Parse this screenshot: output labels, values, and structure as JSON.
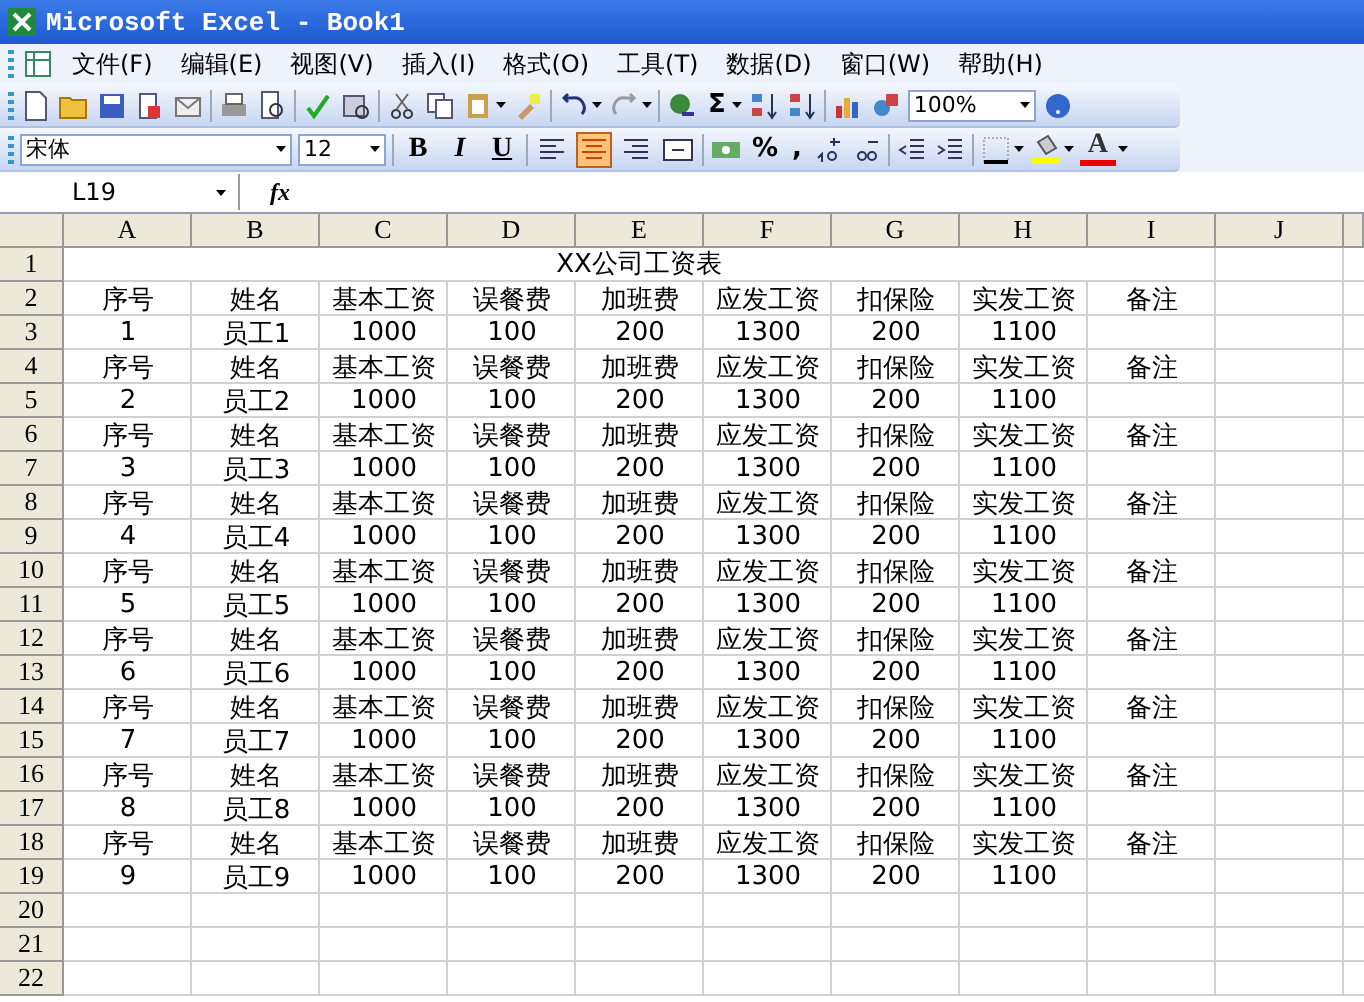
{
  "window": {
    "title": "Microsoft Excel - Book1"
  },
  "menu": [
    {
      "label": "文件(F)"
    },
    {
      "label": "编辑(E)"
    },
    {
      "label": "视图(V)"
    },
    {
      "label": "插入(I)"
    },
    {
      "label": "格式(O)"
    },
    {
      "label": "工具(T)"
    },
    {
      "label": "数据(D)"
    },
    {
      "label": "窗口(W)"
    },
    {
      "label": "帮助(H)"
    }
  ],
  "standard_toolbar": {
    "sum": "Σ",
    "zoom": "100%"
  },
  "formatting_toolbar": {
    "font_name": "宋体",
    "font_size": "12",
    "styles": [
      {
        "label": "B",
        "selected": false
      },
      {
        "label": "I",
        "selected": false
      },
      {
        "label": "U",
        "selected": false
      }
    ],
    "alignment": [
      {
        "kind": "left",
        "selected": false
      },
      {
        "kind": "center",
        "selected": true
      },
      {
        "kind": "right",
        "selected": false
      },
      {
        "kind": "merge",
        "selected": false
      }
    ],
    "percent": "%",
    "comma": ",",
    "font_color": "A"
  },
  "formula_bar": {
    "name_box": "L19",
    "fx": "fx"
  },
  "sheet": {
    "columns": [
      "A",
      "B",
      "C",
      "D",
      "E",
      "F",
      "G",
      "H",
      "I",
      "J"
    ],
    "rows": [
      {
        "number": "1",
        "kind": "title",
        "cells": [
          "XX公司工资表"
        ]
      },
      {
        "number": "2",
        "kind": "data",
        "cells": [
          "序号",
          "姓名",
          "基本工资",
          "误餐费",
          "加班费",
          "应发工资",
          "扣保险",
          "实发工资",
          "备注"
        ]
      },
      {
        "number": "3",
        "kind": "data",
        "cells": [
          "1",
          "员工1",
          "1000",
          "100",
          "200",
          "1300",
          "200",
          "1100"
        ]
      },
      {
        "number": "4",
        "kind": "data",
        "cells": [
          "序号",
          "姓名",
          "基本工资",
          "误餐费",
          "加班费",
          "应发工资",
          "扣保险",
          "实发工资",
          "备注"
        ]
      },
      {
        "number": "5",
        "kind": "data",
        "cells": [
          "2",
          "员工2",
          "1000",
          "100",
          "200",
          "1300",
          "200",
          "1100"
        ]
      },
      {
        "number": "6",
        "kind": "data",
        "cells": [
          "序号",
          "姓名",
          "基本工资",
          "误餐费",
          "加班费",
          "应发工资",
          "扣保险",
          "实发工资",
          "备注"
        ]
      },
      {
        "number": "7",
        "kind": "data",
        "cells": [
          "3",
          "员工3",
          "1000",
          "100",
          "200",
          "1300",
          "200",
          "1100"
        ]
      },
      {
        "number": "8",
        "kind": "data",
        "cells": [
          "序号",
          "姓名",
          "基本工资",
          "误餐费",
          "加班费",
          "应发工资",
          "扣保险",
          "实发工资",
          "备注"
        ]
      },
      {
        "number": "9",
        "kind": "data",
        "cells": [
          "4",
          "员工4",
          "1000",
          "100",
          "200",
          "1300",
          "200",
          "1100"
        ]
      },
      {
        "number": "10",
        "kind": "data",
        "cells": [
          "序号",
          "姓名",
          "基本工资",
          "误餐费",
          "加班费",
          "应发工资",
          "扣保险",
          "实发工资",
          "备注"
        ]
      },
      {
        "number": "11",
        "kind": "data",
        "cells": [
          "5",
          "员工5",
          "1000",
          "100",
          "200",
          "1300",
          "200",
          "1100"
        ]
      },
      {
        "number": "12",
        "kind": "data",
        "cells": [
          "序号",
          "姓名",
          "基本工资",
          "误餐费",
          "加班费",
          "应发工资",
          "扣保险",
          "实发工资",
          "备注"
        ]
      },
      {
        "number": "13",
        "kind": "data",
        "cells": [
          "6",
          "员工6",
          "1000",
          "100",
          "200",
          "1300",
          "200",
          "1100"
        ]
      },
      {
        "number": "14",
        "kind": "data",
        "cells": [
          "序号",
          "姓名",
          "基本工资",
          "误餐费",
          "加班费",
          "应发工资",
          "扣保险",
          "实发工资",
          "备注"
        ]
      },
      {
        "number": "15",
        "kind": "data",
        "cells": [
          "7",
          "员工7",
          "1000",
          "100",
          "200",
          "1300",
          "200",
          "1100"
        ]
      },
      {
        "number": "16",
        "kind": "data",
        "cells": [
          "序号",
          "姓名",
          "基本工资",
          "误餐费",
          "加班费",
          "应发工资",
          "扣保险",
          "实发工资",
          "备注"
        ]
      },
      {
        "number": "17",
        "kind": "data",
        "cells": [
          "8",
          "员工8",
          "1000",
          "100",
          "200",
          "1300",
          "200",
          "1100"
        ]
      },
      {
        "number": "18",
        "kind": "data",
        "cells": [
          "序号",
          "姓名",
          "基本工资",
          "误餐费",
          "加班费",
          "应发工资",
          "扣保险",
          "实发工资",
          "备注"
        ]
      },
      {
        "number": "19",
        "kind": "data",
        "cells": [
          "9",
          "员工9",
          "1000",
          "100",
          "200",
          "1300",
          "200",
          "1100"
        ]
      },
      {
        "number": "20",
        "kind": "data"
      },
      {
        "number": "21",
        "kind": "data"
      },
      {
        "number": "22",
        "kind": "data"
      }
    ]
  }
}
